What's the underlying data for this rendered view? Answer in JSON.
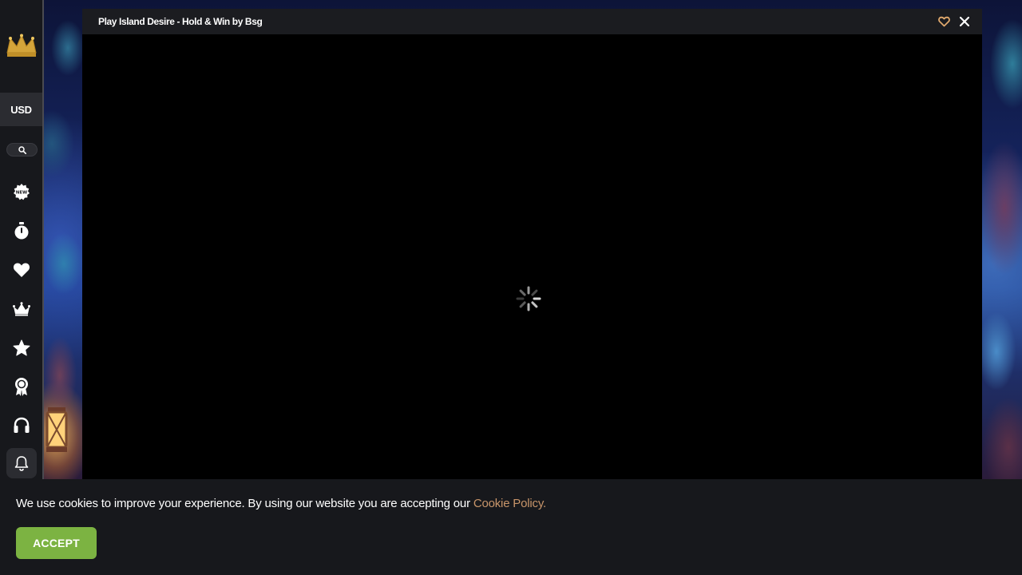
{
  "sidebar": {
    "logo_icon": "crown-logo-icon",
    "currency": "USD",
    "search_icon": "search-icon",
    "nav_icons": [
      "new-badge-icon",
      "stopwatch-icon",
      "heart-icon",
      "crown-icon",
      "star-icon",
      "award-ribbon-icon",
      "headset-icon"
    ],
    "bell_icon": "bell-icon"
  },
  "modal": {
    "title": "Play Island Desire - Hold & Win by Bsg",
    "favorite_icon": "heart-outline-icon",
    "close_icon": "close-icon",
    "loading_icon": "spinner-icon"
  },
  "cookie_banner": {
    "text": "We use cookies to improve your experience. By using our website you are accepting our ",
    "link_text": "Cookie Policy.",
    "accept_label": "ACCEPT"
  },
  "colors": {
    "sidebar_bg": "#17181c",
    "accent_gold": "#c8956a",
    "accept_green": "#7cb342"
  }
}
